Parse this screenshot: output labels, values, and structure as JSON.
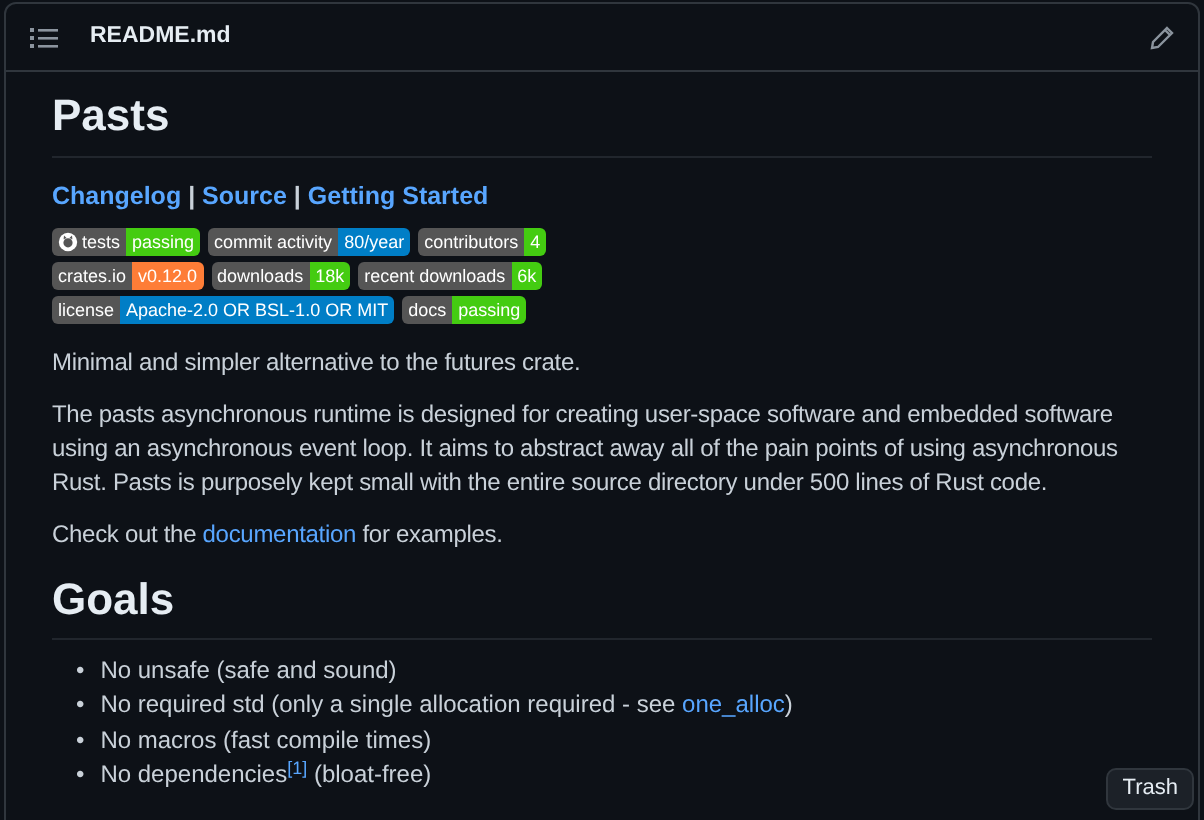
{
  "header": {
    "title": "README.md"
  },
  "title": "Pasts",
  "links": [
    {
      "text": "Changelog"
    },
    {
      "text": "Source"
    },
    {
      "text": "Getting Started"
    }
  ],
  "link_separator": "|",
  "badge_rows": [
    [
      {
        "kind": "logo",
        "label": "tests",
        "value": "passing",
        "color": "#44cc11"
      },
      {
        "kind": "plain",
        "label": "commit activity",
        "value": "80/year",
        "color": "#007ec6"
      },
      {
        "kind": "plain",
        "label": "contributors",
        "value": "4",
        "color": "#44cc11"
      }
    ],
    [
      {
        "kind": "plain",
        "label": "crates.io",
        "value": "v0.12.0",
        "color": "#fe7d37"
      },
      {
        "kind": "plain",
        "label": "downloads",
        "value": "18k",
        "color": "#44cc11"
      },
      {
        "kind": "plain",
        "label": "recent downloads",
        "value": "6k",
        "color": "#44cc11"
      }
    ],
    [
      {
        "kind": "plain",
        "label": "license",
        "value": "Apache-2.0 OR BSL-1.0 OR MIT",
        "color": "#007ec6"
      },
      {
        "kind": "plain",
        "label": "docs",
        "value": "passing",
        "color": "#44cc11"
      }
    ]
  ],
  "paragraphs": [
    {
      "text": "Minimal and simpler alternative to the futures crate."
    },
    {
      "text": "The pasts asynchronous runtime is designed for creating user-space software and embedded software using an asynchronous event loop. It aims to abstract away all of the pain points of using asynchronous Rust. Pasts is purposely kept small with the entire source directory under 500 lines of Rust code."
    },
    {
      "text": "Check out the ",
      "link": "documentation",
      "after": " for examples."
    }
  ],
  "section_title": "Goals",
  "goals": [
    {
      "bullet": "•",
      "text": "No unsafe (safe and sound)"
    },
    {
      "bullet": "•",
      "text": "No required std (only a single allocation required - see ",
      "link": "one_alloc",
      "after": ")"
    },
    {
      "bullet": "•",
      "text": "No macros (fast compile times)"
    },
    {
      "bullet": "•",
      "text": "No dependencies$^{[1]}$ (bloat-free)"
    }
  ],
  "tooltip": "Trash"
}
